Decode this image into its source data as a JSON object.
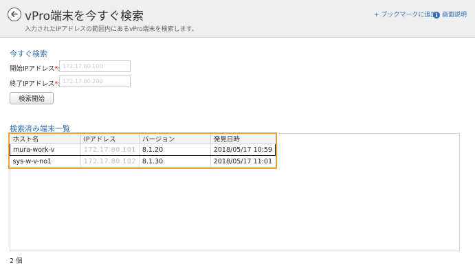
{
  "header": {
    "title": "vPro端末を今すぐ検索",
    "subtitle": "入力されたIPアドレスの範囲内にあるvPro端末を検索します。",
    "bookmark_label": "+ ブックマークに追加",
    "help_icon_glyph": "i",
    "help_label": "画面説明",
    "accent_color": "#2f6fb2"
  },
  "search": {
    "section_title": "今すぐ検索",
    "start_ip_label": "開始IPアドレス",
    "end_ip_label": "終了IPアドレス",
    "required_mark": "*",
    "colon": ":",
    "start_ip_value": "172.17.80.100",
    "end_ip_value": "172.17.80.200",
    "search_button_label": "検索開始"
  },
  "results": {
    "section_title": "検索済み端末一覧",
    "columns": [
      "ホスト名",
      "IPアドレス",
      "バージョン",
      "発見日時"
    ],
    "rows": [
      {
        "host": "mura-work-v",
        "ip": "172.17.80.101",
        "version": "8.1.20",
        "found": "2018/05/17 10:59"
      },
      {
        "host": "sys-w-v-no1",
        "ip": "172.17.80.102",
        "version": "8.1.30",
        "found": "2018/05/17 11:01"
      }
    ],
    "highlight_color": "#f0a030",
    "count_label": "2 個"
  }
}
